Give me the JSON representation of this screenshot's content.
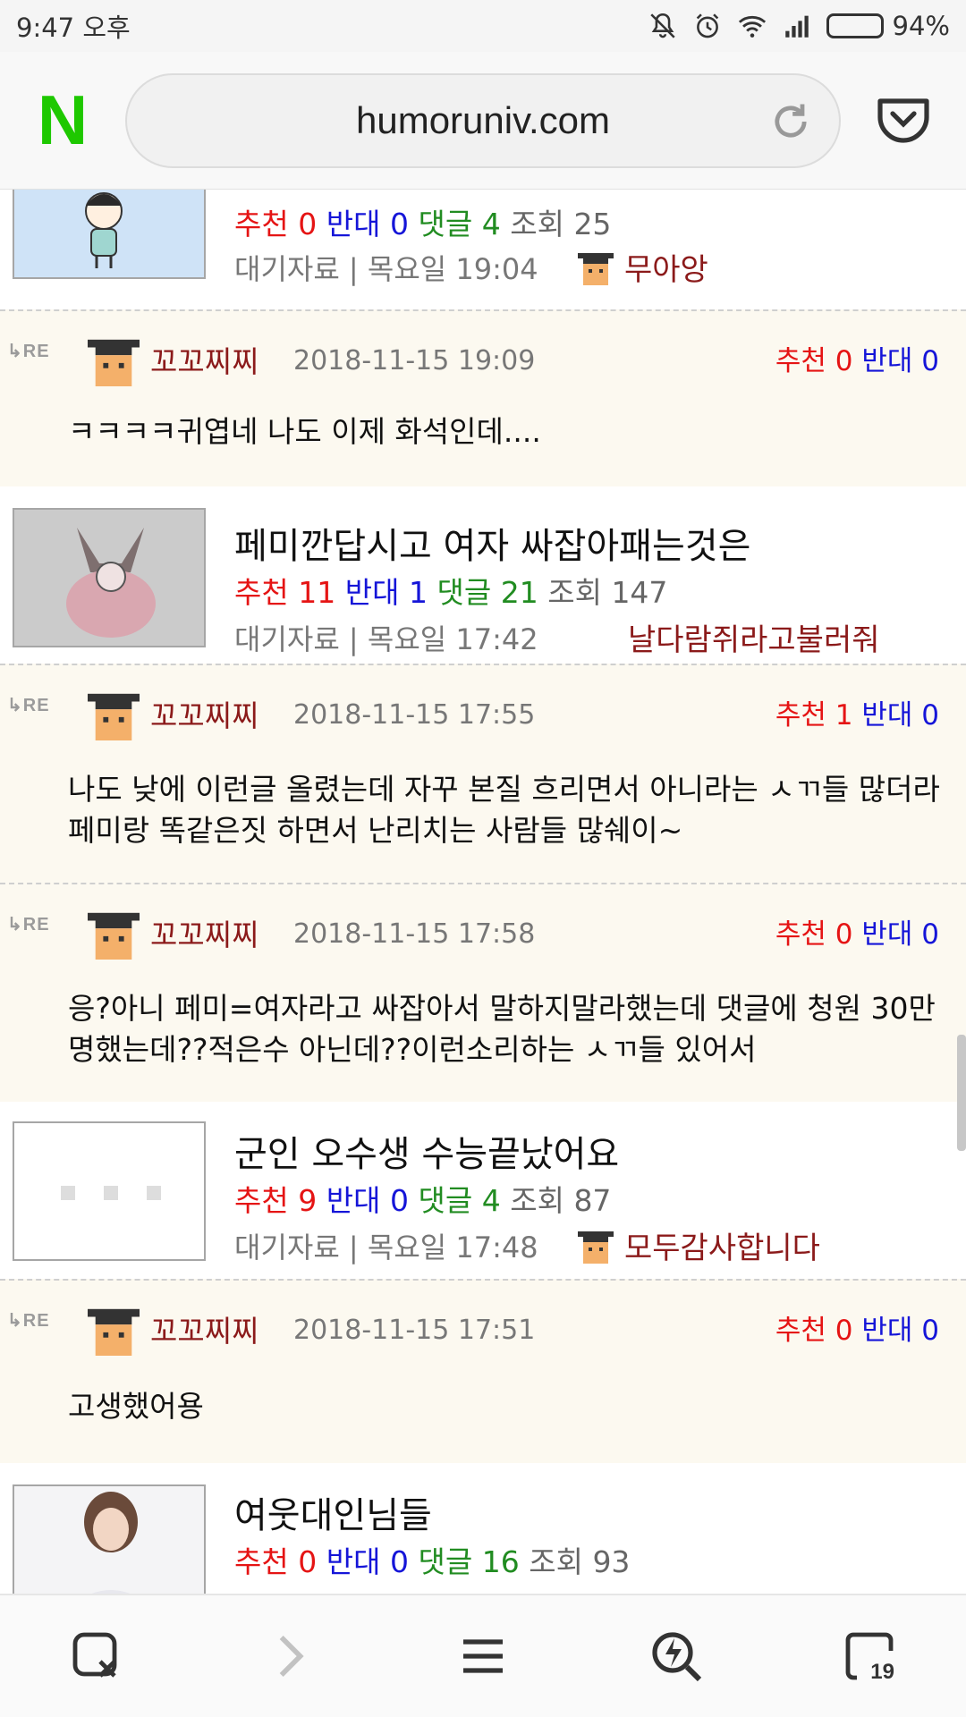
{
  "status_bar": {
    "time": "9:47 오후",
    "battery": "94%",
    "battery_level": 0.94
  },
  "browser": {
    "url": "humoruniv.com",
    "logo": "N",
    "tab_count": "19"
  },
  "labels": {
    "rec": "추천",
    "opp": "반대",
    "cmt": "댓글",
    "view": "조회",
    "re": "RE"
  },
  "posts": [
    {
      "title": "",
      "rec": "0",
      "opp": "0",
      "cmt": "4",
      "view": "25",
      "meta": "대기자료 | 목요일 19:04",
      "author": "무아앙"
    },
    {
      "title": "페미깐답시고 여자 싸잡아패는것은",
      "rec": "11",
      "opp": "1",
      "cmt": "21",
      "view": "147",
      "meta": "대기자료 | 목요일 17:42",
      "author": "날다람쥐라고불러줘"
    },
    {
      "title": "군인 오수생 수능끝났어요",
      "rec": "9",
      "opp": "0",
      "cmt": "4",
      "view": "87",
      "meta": "대기자료 | 목요일 17:48",
      "author": "모두감사합니다"
    },
    {
      "title": "여웃대인님들",
      "rec": "0",
      "opp": "0",
      "cmt": "16",
      "view": "93"
    }
  ],
  "replies": [
    {
      "name": "꼬꼬찌찌",
      "date": "2018-11-15 19:09",
      "rec": "0",
      "opp": "0",
      "text": "ㅋㅋㅋㅋ귀엽네 나도 이제 화석인데...."
    },
    {
      "name": "꼬꼬찌찌",
      "date": "2018-11-15 17:55",
      "rec": "1",
      "opp": "0",
      "text": "나도 낮에 이런글 올렸는데 자꾸 본질 흐리면서 아니라는 ㅅㄲ들 많더라 페미랑 똑같은짓 하면서 난리치는 사람들 많쉐이~"
    },
    {
      "name": "꼬꼬찌찌",
      "date": "2018-11-15 17:58",
      "rec": "0",
      "opp": "0",
      "text": "응?아니 페미=여자라고 싸잡아서 말하지말라했는데 댓글에 청원 30만명했는데??적은수 아닌데??이런소리하는 ㅅㄲ들 있어서"
    },
    {
      "name": "꼬꼬찌찌",
      "date": "2018-11-15 17:51",
      "rec": "0",
      "opp": "0",
      "text": "고생했어용"
    }
  ]
}
